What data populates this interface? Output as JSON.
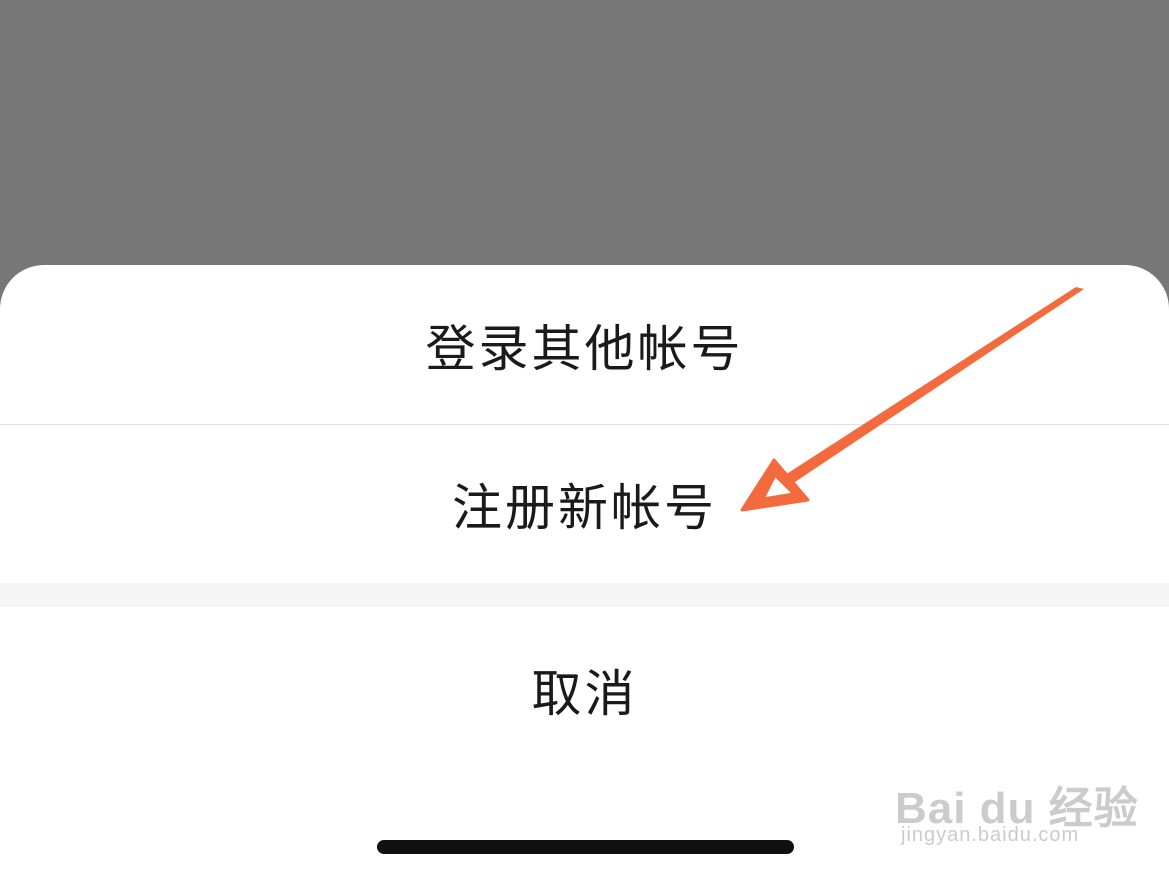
{
  "action_sheet": {
    "items": [
      {
        "label": "登录其他帐号"
      },
      {
        "label": "注册新帐号"
      }
    ],
    "cancel_label": "取消"
  },
  "annotation": {
    "arrow_color": "#f26a3d",
    "icon": "arrow-pointer-icon"
  },
  "watermark": {
    "logo_text": "Bai du 经验",
    "url": "jingyan.baidu.com"
  },
  "colors": {
    "overlay": "#777777",
    "sheet": "#ffffff",
    "divider": "#e2e2e2",
    "gap": "#f5f5f5",
    "text": "#1a1a1a",
    "home_indicator": "#111111"
  }
}
